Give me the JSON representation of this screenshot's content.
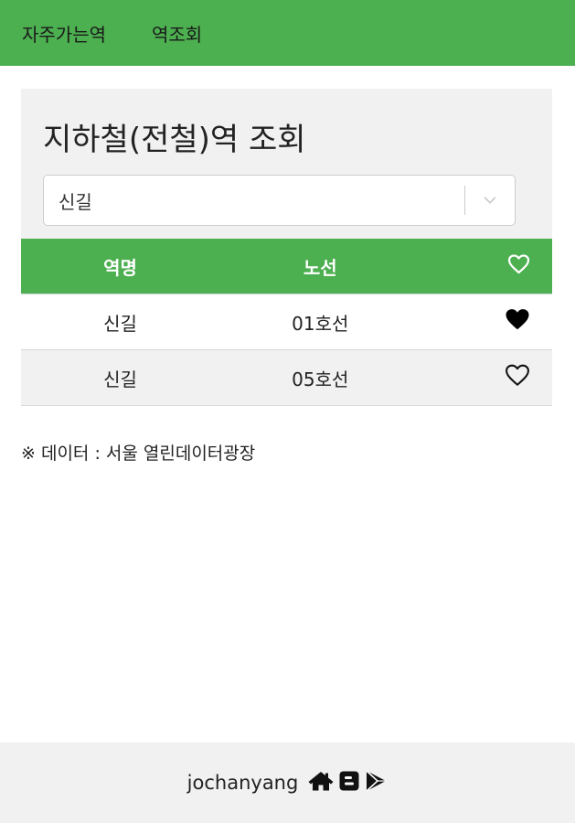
{
  "nav": {
    "items": [
      {
        "label": "자주가는역"
      },
      {
        "label": "역조회"
      }
    ],
    "bg_color": "#4caf50"
  },
  "panel": {
    "title": "지하철(전철)역 조회",
    "select": {
      "value": "신길"
    }
  },
  "table": {
    "headers": {
      "name": "역명",
      "line": "노선",
      "favorite_icon": "heart-outline-icon"
    },
    "rows": [
      {
        "name": "신길",
        "line": "01호선",
        "favorite": true
      },
      {
        "name": "신길",
        "line": "05호선",
        "favorite": false
      }
    ]
  },
  "source_note": "※ 데이터 : 서울 열린데이터광장",
  "footer": {
    "author": "jochanyang",
    "icons": [
      "home-icon",
      "blogger-icon",
      "play-store-icon"
    ]
  }
}
